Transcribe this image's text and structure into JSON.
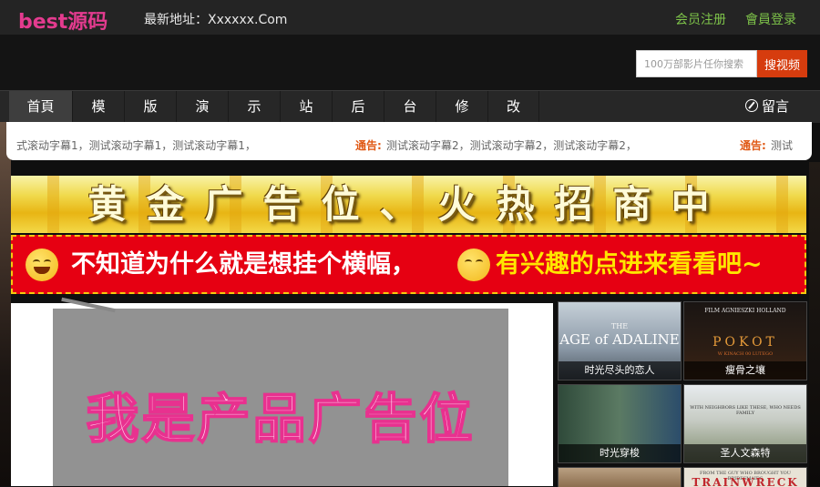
{
  "header": {
    "logo": "best源码",
    "address_label": "最新地址：Xxxxxx.Com",
    "register": "会员注册",
    "login": "會員登录"
  },
  "search": {
    "placeholder": "100万部影片任你搜索",
    "button": "搜视频"
  },
  "nav": {
    "items": [
      "首頁",
      "模",
      "版",
      "演",
      "示",
      "站",
      "后",
      "台",
      "修",
      "改"
    ],
    "guestbook": "留言"
  },
  "ticker": {
    "segment1_text": "式滚动字幕1，测试滚动字幕1，测试滚动字幕1，",
    "segment2_label": "通告:",
    "segment2_text": "测试滚动字幕2，测试滚动字幕2，测试滚动字幕2，",
    "segment3_label": "通告:",
    "segment3_text": "测试"
  },
  "banners": {
    "gold": "黄金广告位、火热招商中",
    "red_left": "不知道为什么就是想挂个横幅，",
    "red_right": "有兴趣的点进来看看吧~"
  },
  "product_ad": {
    "text": "我是产品广告位"
  },
  "movies": [
    {
      "title": "时光尽头的恋人",
      "poster_text": "AGE of ADALINE",
      "poster_sub": "THE"
    },
    {
      "title": "瘦骨之壤",
      "poster_text": "POKOT",
      "poster_sub": "FILM AGNIESZKI HOLLAND",
      "poster_sub2": "W KINACH 00 LUTEGO"
    },
    {
      "title": "时光穿梭",
      "poster_text": "",
      "poster_sub": ""
    },
    {
      "title": "圣人文森特",
      "poster_text": "",
      "poster_sub": "WITH NEIGHBORS LIKE THESE, WHO NEEDS FAMILY"
    },
    {
      "title": "",
      "poster_text": "",
      "poster_sub": ""
    },
    {
      "title": "",
      "poster_text": "TRAINWRECK",
      "poster_sub": "FROM THE GUY WHO BROUGHT YOU BRIDESMAIDS"
    }
  ],
  "colors": {
    "logo": "#e43b8f",
    "toplinks": "#7ec34a",
    "search_button": "#d63c0e",
    "notice_label": "#e05a16",
    "red_banner": "#e60012"
  },
  "icons": {
    "guestbook": "compass-icon"
  }
}
